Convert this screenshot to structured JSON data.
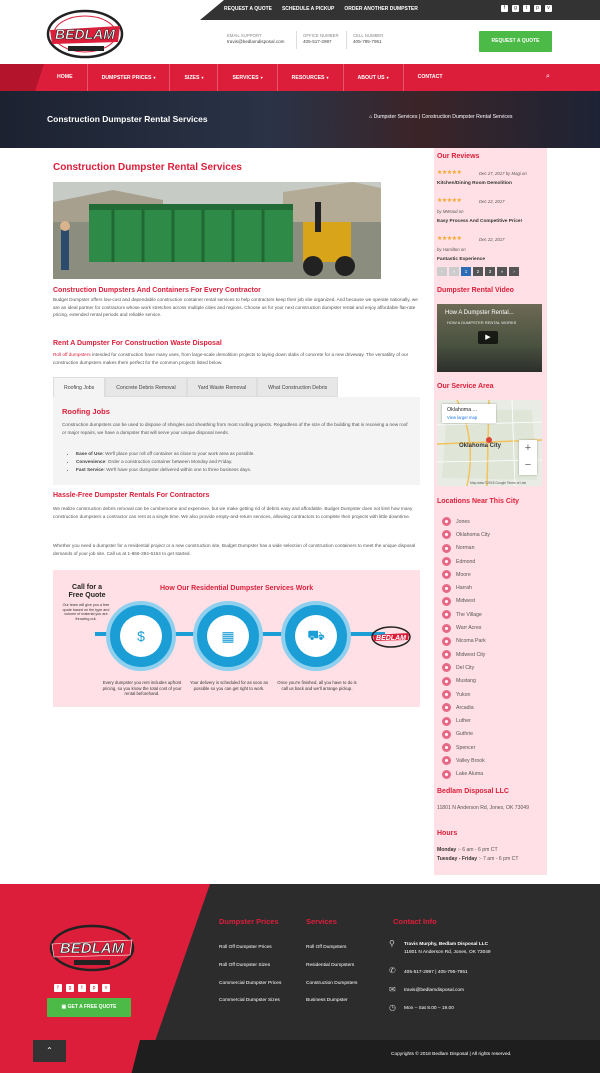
{
  "topbar": {
    "links": [
      "REQUEST A QUOTE",
      "SCHEDULE A PICKUP",
      "ORDER ANOTHER DUMPSTER"
    ],
    "social_icons": [
      "facebook-icon",
      "google-plus-icon",
      "twitter-icon",
      "pinterest-icon",
      "vine-icon"
    ]
  },
  "header": {
    "email_label": "EMAIL SUPPORT",
    "email": "travis@bedlamdisposal.com",
    "office_label": "OFFICE NUMBER",
    "office": "405-517-2997",
    "cell_label": "CELL NUMBER",
    "cell": "405-795-7951",
    "quote_button": "REQUEST A QUOTE"
  },
  "nav": {
    "items": [
      "HOME",
      "DUMPSTER PRICES",
      "SIZES",
      "SERVICES",
      "RESOURCES",
      "ABOUT US",
      "CONTACT"
    ],
    "caret": "▾",
    "search": "⌕"
  },
  "banner": {
    "title": "Construction Dumpster Rental Services",
    "breadcrumb": "Dumpster Services | Construction Dumpster Rental Services",
    "home_icon": "⌂"
  },
  "main": {
    "title": "Construction Dumpster Rental Services",
    "h_containers": "Construction Dumpsters And Containers For Every Contractor",
    "p_containers": "Budget Dumpster offers low-cost and dependable construction container rental services to help contractors keep their job site organized. And because we operate nationally, we are an ideal partner for contractors whose work stretches across multiple cities and regions. Choose us for your next construction dumpster rental and enjoy affordable flat-rate pricing, extended rental periods and reliable service.",
    "h_rent": "Rent A Dumpster For Construction Waste Disposal",
    "p_rent_link": "Roll off dumpsters",
    "p_rent": " intended for construction have many uses, from large-scale demolition projects to laying down slabs of concrete for a new driveway. The versatility of our construction dumpsters makes them perfect for the common projects listed below.",
    "tabs": [
      "Roofing Jobs",
      "Concrete Debris Removal",
      "Yard Waste Removal",
      "What Construction Debris"
    ],
    "tab_panel_title": "Roofing Jobs",
    "tab_panel_text": "Construction dumpsters can be used to dispose of shingles and sheathing from most roofing projects. Regardless of the size of the building that is receiving a new roof or major repairs, we have a dumpster that will serve your unique disposal needs.",
    "bullets": [
      {
        "label": "Ease of Use",
        "text": ": We'll place your roll off container as close to your work area as possible."
      },
      {
        "label": "Convenience",
        "text": ": Order a construction container between Monday and Friday."
      },
      {
        "label": "Fast Service",
        "text": ": We'll have your dumpster delivered within one to three business days."
      }
    ],
    "h_hassle": "Hassle-Free Dumpster Rentals For Contractors",
    "p_hassle": "We realize construction debris removal can be cumbersome and expensive, but we make getting rid of debris easy and affordable. Budget Dumpster does not limit how many construction dumpsters a contractor can rent at a single time. We also provide empty-and-return services, allowing contractors to complete their projects with little downtime.",
    "p_final": "Whether you need a dumpster for a residential project or a new construction site, Budget Dumpster has a wide selection of construction containers to meet the unique disposal demands of your job site. Call us at 1-866-284-6164 to get started."
  },
  "infographic": {
    "cta_title": "Call for a Free Quote",
    "cta_text": "Our team will give you a free quote based on the type and volume of material you are throwing out.",
    "title": "How Our Residential Dumpster Services Work",
    "steps": [
      {
        "icon": "money-handshake-icon",
        "glyph": "$",
        "text": "Every dumpster you rent includes upfront pricing, so you know the total cost of your rental beforehand."
      },
      {
        "icon": "calendar-icon",
        "glyph": "▦",
        "text": "Your delivery is scheduled for as soon as possible so you can get right to work."
      },
      {
        "icon": "truck-icon",
        "glyph": "⛟",
        "text": "Once you're finished, all you have to do is call us back and we'll arrange pickup."
      }
    ]
  },
  "sidebar": {
    "reviews_title": "Our Reviews",
    "reviews": [
      {
        "stars": "★★★★★",
        "date": "Dec 27, 2017",
        "author": "by Magi on",
        "title": "Kitchen/Dining Room Demolition"
      },
      {
        "stars": "★★★★★",
        "date": "Dec 22, 2017",
        "author": "by MWood on",
        "title": "Easy Process And Competitive Price!"
      },
      {
        "stars": "★★★★★",
        "date": "Dec 22, 2017",
        "author": "by Hamilton on",
        "title": "Fantastic Experience"
      }
    ],
    "pager": [
      "‹",
      "«",
      "1",
      "2",
      "3",
      "»",
      "›"
    ],
    "video_title": "Dumpster Rental Video",
    "video_caption": "How A Dumpster Rental...",
    "video_sub": "HOW A DUMPSTER RENTAL WORKS",
    "video_play": "▶",
    "area_title": "Our Service Area",
    "map_name": "Oklahoma ...",
    "map_link": "View larger map",
    "map_city": "Oklahoma City",
    "map_zoom_in": "+",
    "map_zoom_out": "−",
    "map_footer": "Map data ©2018 Google   Terms of Use",
    "locations_title": "Locations Near This City",
    "locations": [
      "Jones",
      "Oklahoma City",
      "Norman",
      "Edmond",
      "Moore",
      "Harrah",
      "Midwest",
      "The Village",
      "Warr Acres",
      "Nicoma Park",
      "Midwest City",
      "Del City",
      "Mustang",
      "Yukon",
      "Arcadia",
      "Luther",
      "Guthrie",
      "Spencer",
      "Valley Brook",
      "Lake Aluma"
    ],
    "company_title": "Bedlam Disposal LLC",
    "address": "11801 N Anderson Rd, Jones, OK 73049",
    "hours_title": "Hours",
    "hours": [
      {
        "day": "Monday",
        "time": " :- 6 am - 6 pm CT"
      },
      {
        "day": "Tuesday - Friday",
        "time": " :- 7 am - 6 pm CT"
      }
    ]
  },
  "footer": {
    "social_icons": [
      "facebook-icon",
      "google-plus-icon",
      "twitter-icon",
      "pinterest-icon",
      "vine-icon"
    ],
    "quote_button": "GET A FREE QUOTE",
    "col1_title": "Dumpster Prices",
    "col1_links": [
      "Roll Off Dumpster Prices",
      "Roll Off Dumpster Sizes",
      "Commercial Dumpster Prices",
      "Commercial Dumpster Sizes"
    ],
    "col2_title": "Services",
    "col2_links": [
      "Roll Off Dumpsters",
      "Residential Dumpsters",
      "Construction Dumpsters",
      "Business Dumpster"
    ],
    "col3_title": "Contact Info",
    "contact_name": "Travis Murphy, Bedlam Disposal LLC",
    "contact_address": "11801 N Anderson Rd, Jones, OK 73049",
    "contact_phone": "405-517-2997 | 405-795-7951",
    "contact_email": "travis@bedlamdisposal.com",
    "contact_hours": "Mon – Sat 8.00 – 19.00",
    "copyright": "Copyrights © 2018 Bedlam Disposal | All rights reserved.",
    "to_top": "⌃"
  },
  "colors": {
    "accent": "#dc1e3a",
    "green": "#4cba47",
    "blue": "#1b9ed6",
    "pink_bg": "#ffe0e6",
    "dark": "#2c2c2c"
  }
}
